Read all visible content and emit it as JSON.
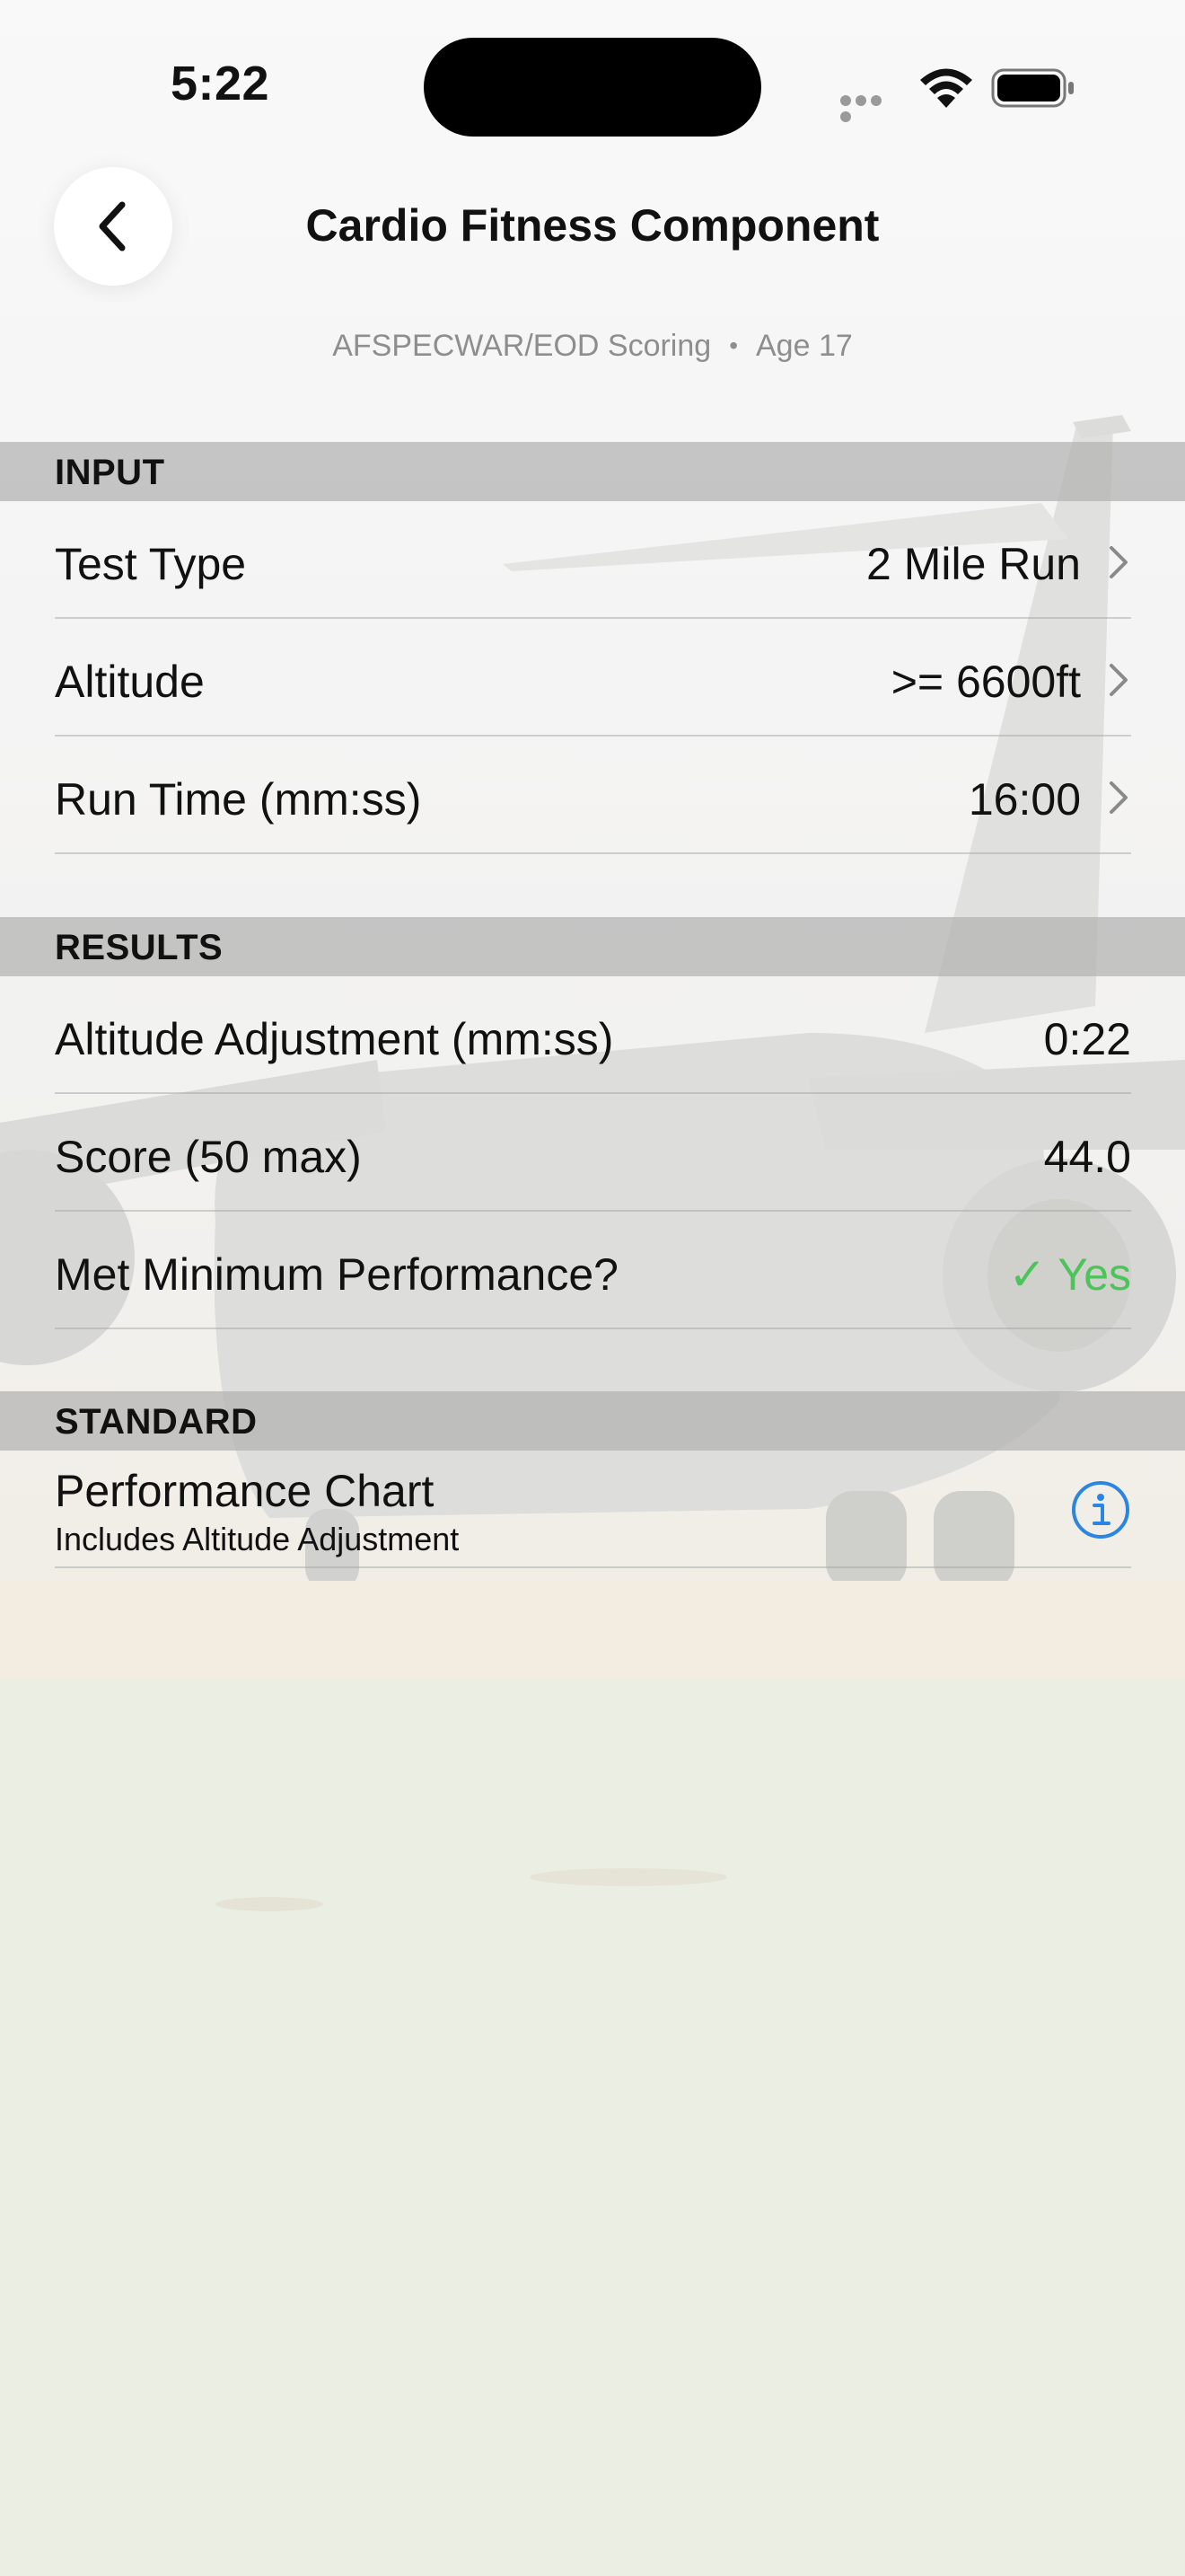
{
  "status_bar": {
    "time": "5:22"
  },
  "header": {
    "title": "Cardio Fitness Component",
    "subtitle_scoring": "AFSPECWAR/EOD Scoring",
    "subtitle_separator": "•",
    "subtitle_age": "Age 17",
    "back_icon": "chevron-left-icon"
  },
  "sections": {
    "input": {
      "title": "INPUT",
      "rows": [
        {
          "label": "Test Type",
          "value": "2 Mile Run"
        },
        {
          "label": "Altitude",
          "value": ">= 6600ft"
        },
        {
          "label": "Run Time (mm:ss)",
          "value": "16:00"
        }
      ]
    },
    "results": {
      "title": "RESULTS",
      "rows": [
        {
          "label": "Altitude Adjustment (mm:ss)",
          "value": "0:22"
        },
        {
          "label": "Score (50 max)",
          "value": "44.0"
        },
        {
          "label": "Met Minimum Performance?",
          "value": "✓ Yes",
          "status_color": "#4cc45a"
        }
      ]
    },
    "standard": {
      "title": "STANDARD",
      "rows": [
        {
          "label": "Performance Chart",
          "sublabel": "Includes Altitude Adjustment",
          "icon": "info-icon",
          "icon_color": "#2a86e0"
        }
      ]
    }
  },
  "colors": {
    "section_header_bg": "#b2b2b2",
    "success": "#4cc45a",
    "accent": "#2a86e0"
  }
}
